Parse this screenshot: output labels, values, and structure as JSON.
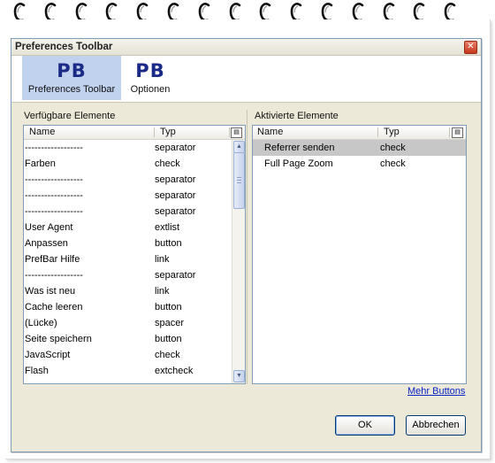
{
  "window": {
    "title": "Preferences Toolbar"
  },
  "tabs": [
    {
      "logo": "PB",
      "label": "Preferences Toolbar",
      "selected": true
    },
    {
      "logo": "PB",
      "label": "Optionen",
      "selected": false
    }
  ],
  "left_panel": {
    "label": "Verfügbare Elemente",
    "columns": [
      "Name",
      "Typ"
    ],
    "rows": [
      {
        "name": "------------------",
        "type": "separator"
      },
      {
        "name": "Farben",
        "type": "check"
      },
      {
        "name": "------------------",
        "type": "separator"
      },
      {
        "name": "------------------",
        "type": "separator"
      },
      {
        "name": "------------------",
        "type": "separator"
      },
      {
        "name": "User Agent",
        "type": "extlist"
      },
      {
        "name": "Anpassen",
        "type": "button"
      },
      {
        "name": "PrefBar Hilfe",
        "type": "link"
      },
      {
        "name": "------------------",
        "type": "separator"
      },
      {
        "name": "Was ist neu",
        "type": "link"
      },
      {
        "name": "Cache leeren",
        "type": "button"
      },
      {
        "name": "(Lücke)",
        "type": "spacer"
      },
      {
        "name": "Seite speichern",
        "type": "button"
      },
      {
        "name": "JavaScript",
        "type": "check"
      },
      {
        "name": "Flash",
        "type": "extcheck"
      }
    ]
  },
  "right_panel": {
    "label": "Aktivierte Elemente",
    "columns": [
      "Name",
      "Typ"
    ],
    "rows": [
      {
        "name": "Referrer senden",
        "type": "check",
        "selected": true
      },
      {
        "name": "Full Page Zoom",
        "type": "check",
        "selected": false
      }
    ]
  },
  "more_link": "Mehr Buttons",
  "buttons": {
    "ok": "OK",
    "cancel": "Abbrechen"
  },
  "colors": {
    "logo": "#1b2a86",
    "selected_tab": "#c1d2ee",
    "link": "#0a24c7",
    "close": "#c6371c"
  }
}
